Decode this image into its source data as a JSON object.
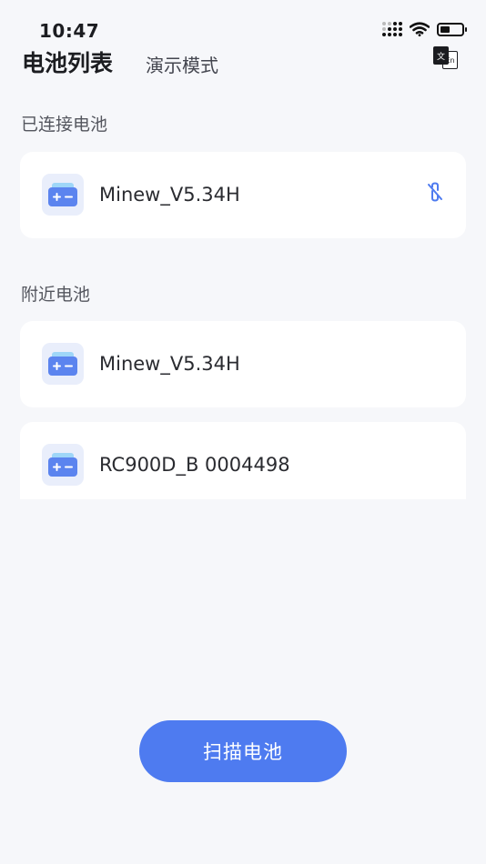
{
  "status_bar": {
    "time": "10:47"
  },
  "header": {
    "title": "电池列表",
    "demo_mode": "演示模式",
    "lang_zh": "文",
    "lang_en": "En"
  },
  "connected": {
    "label": "已连接电池",
    "items": [
      {
        "name": "Minew_V5.34H"
      }
    ]
  },
  "nearby": {
    "label": "附近电池",
    "items": [
      {
        "name": "Minew_V5.34H"
      },
      {
        "name": "RC900D_B 0004498"
      }
    ]
  },
  "scan_button": {
    "label": "扫描电池"
  },
  "colors": {
    "accent": "#4e7bf0",
    "background": "#f6f7fa",
    "icon_bg": "#e9eefb"
  }
}
